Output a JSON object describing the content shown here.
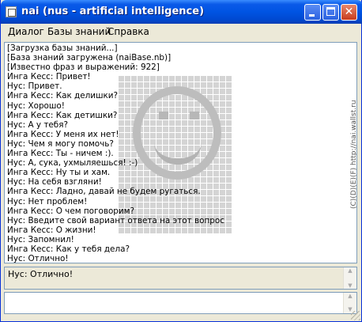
{
  "window": {
    "title": "nai (nus - artificial intelligence)"
  },
  "menu": [
    {
      "label": "Диалог"
    },
    {
      "label": "Базы знаний"
    },
    {
      "label": "Справка"
    }
  ],
  "log": {
    "lines": [
      "[Загрузка базы знаний...]",
      "[База знаний загружена (naiBase.nb)]",
      "[Известно фраз и выражений: 922]",
      "Инга Кесс: Привет!",
      "Нус: Привет.",
      "Инга Кесс: Как делишки?",
      "Нус: Хорошо!",
      "Инга Кесс: Как детишки?",
      "Нус: А у тебя?",
      "Инга Кесс: У меня их нет!",
      "Нус: Чем я могу помочь?",
      "Инга Кесс: Ты - ничем :).",
      "Нус: А, сука, ухмыляешься! :-)",
      "Инга Кесс: Ну ты и хам.",
      "Нус: На себя взгляни!",
      "Инга Кесс: Ладно, давай не будем ругаться.",
      "Нус: Нет проблем!",
      "Инга Кесс: О чем поговорим?",
      "Нус: Введите свой вариант ответа на этот вопрос",
      "Инга Кесс: О жизни!",
      "Нус: Запомнил!",
      "Инга Кесс: Как у тебя дела?",
      "Нус: Отлично!"
    ],
    "side_text": "(C)(D)(E)(F) http://nai.wallst.ru"
  },
  "answer": {
    "text": "Нус: Отлично!"
  },
  "input": {
    "value": "",
    "placeholder": ""
  },
  "colors": {
    "titlebar": "#0054e3",
    "close": "#c83c1e",
    "border": "#7f9db9"
  }
}
